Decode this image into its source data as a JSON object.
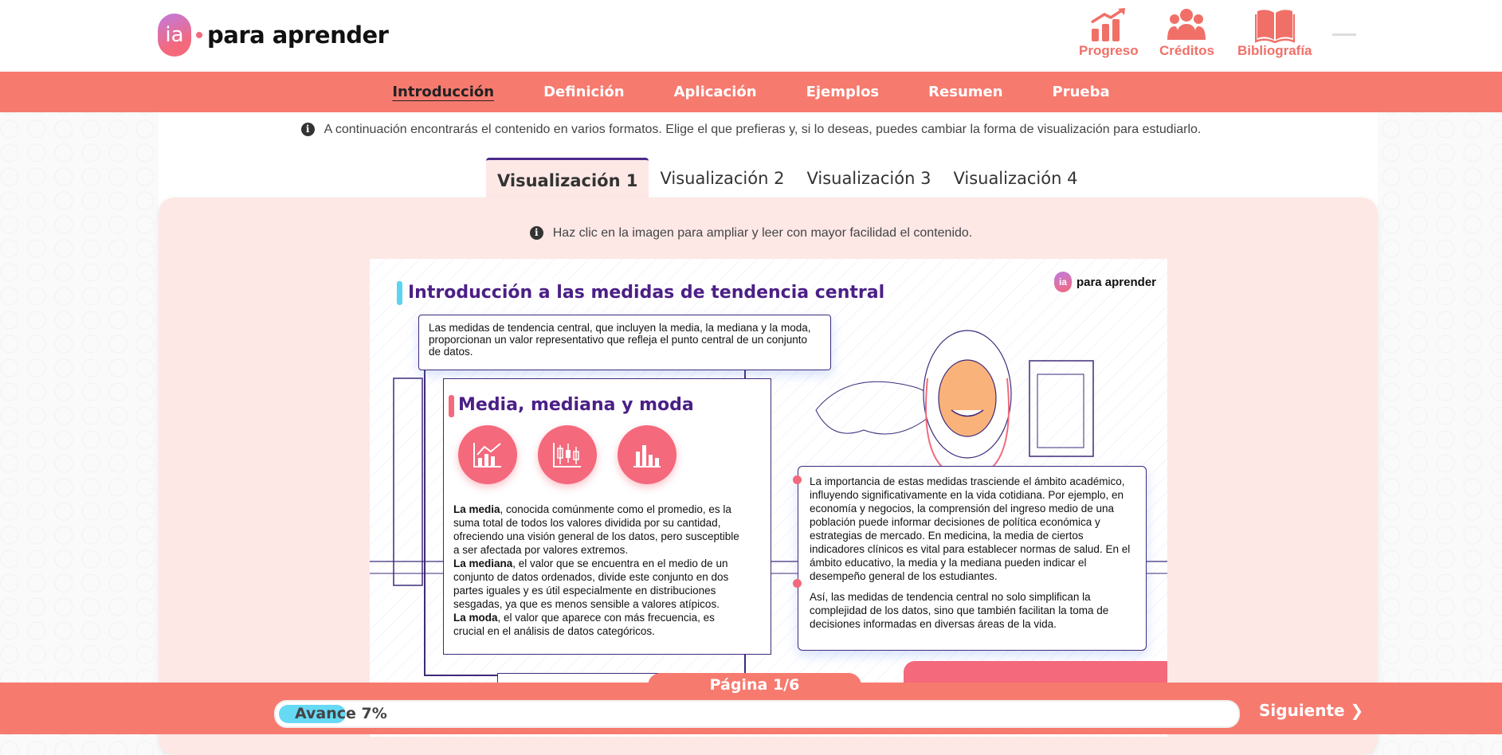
{
  "brand": {
    "badge": "ia",
    "name": "para aprender"
  },
  "header_nav": [
    {
      "label": "Progreso",
      "icon": "chart-up-icon"
    },
    {
      "label": "Créditos",
      "icon": "people-icon"
    },
    {
      "label": "Bibliografía",
      "icon": "book-icon"
    }
  ],
  "main_nav": [
    "Introducción",
    "Definición",
    "Aplicación",
    "Ejemplos",
    "Resumen",
    "Prueba"
  ],
  "info_text": "A continuación encontrarás el contenido en varios formatos. Elige el que prefieras y, si lo deseas, puedes cambiar la forma de visualización para estudiarlo.",
  "tabs": [
    "Visualización 1",
    "Visualización 2",
    "Visualización 3",
    "Visualización 4"
  ],
  "panel_info": "Haz clic en la imagen para ampliar y leer con mayor facilidad el contenido.",
  "infographic": {
    "title": "Introducción a las medidas de tendencia central",
    "logo_badge": "ia",
    "logo_text": "para aprender",
    "intro": "Las medidas de tendencia central, que incluyen la media, la mediana y la moda, proporcionan un valor representativo que refleja el punto central de un conjunto de datos.",
    "subtitle": "Media, mediana y moda",
    "media_term": "La media",
    "media_text": ", conocida comúnmente como el promedio, es la suma total de todos los valores dividida por su cantidad, ofreciendo una visión general de los datos, pero susceptible a ser afectada por valores extremos.",
    "mediana_term": "La mediana",
    "mediana_text": ", el valor que se encuentra en el medio de un conjunto de datos ordenados, divide este conjunto en dos partes iguales y es útil especialmente en distribuciones sesgadas, ya que es menos sensible a valores atípicos.",
    "moda_term": "La moda",
    "moda_text": ", el valor que aparece con más frecuencia, es crucial en el análisis de datos categóricos.",
    "importance": "La importancia de estas medidas trasciende el ámbito académico, influyendo significativamente en la vida cotidiana. Por ejemplo, en economía y negocios, la comprensión del ingreso medio de una población puede informar decisiones de política económica y estrategias de mercado. En medicina, la media de ciertos indicadores clínicos es vital para establecer normas de salud. En el ámbito educativo, la media y la mediana pueden indicar el desempeño general de los estudiantes.",
    "conclusion": "Así, las medidas de tendencia central no solo simplifican la complejidad de los datos, sino que también facilitan la toma de decisiones informadas en diversas áreas de la vida."
  },
  "page_label": "Página 1/6",
  "progress": {
    "label": "Avance 7%",
    "value": 0.07
  },
  "next_label": "Siguiente ❯",
  "colors": {
    "accent": "#f77a6f",
    "purple": "#4b1f86",
    "progress": "#66d9f5"
  }
}
